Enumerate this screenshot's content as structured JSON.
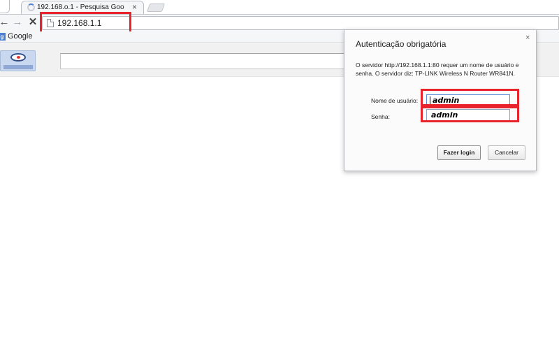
{
  "browser": {
    "tab_title": "192.168.o.1 - Pesquisa Goo",
    "tab_close": "×",
    "address": "192.168.1.1",
    "nav": {
      "back": "←",
      "forward": "→",
      "stop": "✕"
    }
  },
  "bookmarks": {
    "items": [
      {
        "label": "Google",
        "icon": "google-icon"
      }
    ]
  },
  "auth_dialog": {
    "title": "Autenticação obrigatória",
    "close": "×",
    "message": "O servidor http://192.168.1.1:80 requer um nome de usuário e senha. O servidor diz: TP-LINK Wireless N Router WR841N.",
    "username_label": "Nome de usuário:",
    "username_value": "admin",
    "password_label": "Senha:",
    "password_value": "admin",
    "login_button": "Fazer login",
    "cancel_button": "Cancelar"
  },
  "colors": {
    "highlight": "#e8232b",
    "dialog_bg": "#fbfbfb"
  }
}
